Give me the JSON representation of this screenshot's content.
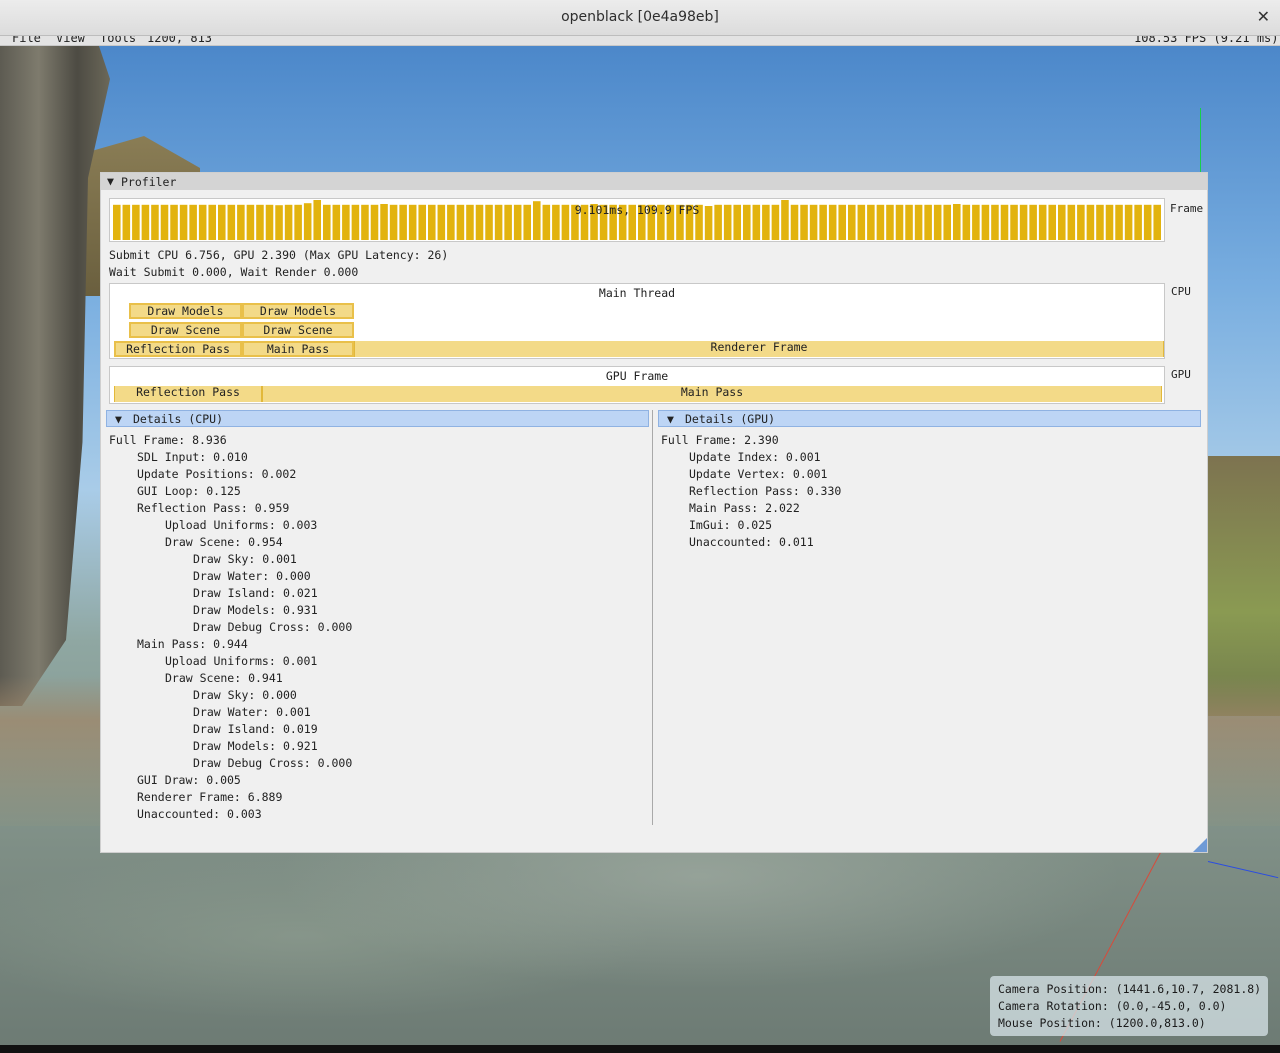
{
  "window": {
    "title": "openblack [0e4a98eb]"
  },
  "menu": {
    "file": "File",
    "view": "View",
    "tools": "Tools",
    "resolution": "1200, 813",
    "fps": "108.53 FPS (9.21 ms)"
  },
  "profiler": {
    "title": "Profiler",
    "frame_graph": {
      "label": "9.101ms, 109.9 FPS",
      "side_label": "Frame",
      "bar_levels": [
        0.88,
        0.88,
        0.88,
        0.88,
        0.88,
        0.88,
        0.88,
        0.88,
        0.88,
        0.88,
        0.88,
        0.88,
        0.88,
        0.88,
        0.88,
        0.88,
        0.88,
        0.88,
        0.88,
        0.88,
        0.88,
        0.88,
        0.88,
        0.88,
        0.88,
        0.88,
        0.88,
        0.88,
        0.88,
        0.88,
        0.88,
        0.88,
        0.88,
        0.88,
        0.88,
        0.88,
        0.88,
        0.88,
        0.88,
        0.88,
        0.88,
        0.88,
        0.88,
        0.88,
        0.88,
        0.88,
        0.88,
        0.88,
        0.88,
        0.88,
        0.88,
        0.88,
        0.88,
        0.88,
        0.88,
        0.88,
        0.88,
        0.88,
        0.88,
        0.88,
        0.88,
        0.88,
        0.88,
        0.88,
        0.88,
        0.88,
        0.88,
        0.88,
        0.88,
        0.88,
        0.88,
        0.88,
        0.88,
        0.88,
        0.88,
        0.88,
        0.88,
        0.88,
        0.88,
        0.88,
        0.88,
        0.88,
        0.88,
        0.88,
        0.88,
        0.88,
        0.88,
        0.88,
        0.88,
        0.88,
        0.88,
        0.88,
        0.88,
        0.88,
        0.88,
        0.88,
        0.88,
        0.88,
        0.88,
        0.88,
        0.88,
        0.88,
        0.88,
        0.88,
        0.88,
        0.88,
        0.88,
        0.88,
        0.88,
        0.88
      ],
      "spikes": [
        [
          21,
          1.0
        ],
        [
          44,
          0.97
        ],
        [
          70,
          1.0
        ],
        [
          20,
          0.92
        ],
        [
          28,
          0.9
        ],
        [
          17,
          0.87
        ],
        [
          50,
          0.9
        ],
        [
          62,
          0.85
        ],
        [
          88,
          0.9
        ]
      ]
    },
    "submit_line": "Submit CPU 6.756, GPU 2.390 (Max GPU Latency: 26)",
    "wait_line": "Wait Submit 0.000, Wait Render 0.000",
    "cpu": {
      "title": "Main Thread",
      "side_label": "CPU",
      "row3": {
        "reflection": "Reflection Pass",
        "main": "Main Pass",
        "renderer": "Renderer Frame"
      },
      "row2": {
        "a": "Draw Scene",
        "b": "Draw Scene"
      },
      "row1": {
        "a": "Draw Models",
        "b": "Draw Models"
      }
    },
    "gpu": {
      "title": "GPU Frame",
      "side_label": "GPU",
      "reflection": "Reflection Pass",
      "main": "Main Pass"
    },
    "details_cpu": {
      "header": "Details (CPU)",
      "lines": [
        "Full Frame: 8.936",
        "SDL Input: 0.010",
        "Update Positions: 0.002",
        "GUI Loop: 0.125",
        "Reflection Pass: 0.959",
        "Upload Uniforms: 0.003",
        "Draw Scene: 0.954",
        "Draw Sky: 0.001",
        "Draw Water: 0.000",
        "Draw Island: 0.021",
        "Draw Models: 0.931",
        "Draw Debug Cross: 0.000",
        "Main Pass: 0.944",
        "Upload Uniforms: 0.001",
        "Draw Scene: 0.941",
        "Draw Sky: 0.000",
        "Draw Water: 0.001",
        "Draw Island: 0.019",
        "Draw Models: 0.921",
        "Draw Debug Cross: 0.000",
        "GUI Draw: 0.005",
        "Renderer Frame: 6.889",
        "Unaccounted: 0.003"
      ],
      "indents": [
        0,
        1,
        1,
        1,
        1,
        2,
        2,
        3,
        3,
        3,
        3,
        3,
        1,
        2,
        2,
        3,
        3,
        3,
        3,
        3,
        1,
        1,
        1
      ]
    },
    "details_gpu": {
      "header": "Details (GPU)",
      "lines": [
        "Full Frame: 2.390",
        "Update Index: 0.001",
        "Update Vertex: 0.001",
        "Reflection Pass: 0.330",
        "Main Pass: 2.022",
        "ImGui: 0.025",
        "Unaccounted: 0.011"
      ],
      "indents": [
        0,
        1,
        1,
        1,
        1,
        1,
        1
      ]
    }
  },
  "camera": {
    "position": "Camera Position: (1441.6,10.7, 2081.8)",
    "rotation": "Camera Rotation: (0.0,-45.0, 0.0)",
    "mouse": "Mouse Position: (1200.0,813.0)"
  },
  "colors": {
    "bar": "#e2b30e",
    "segment_fill": "#f3da88",
    "segment_border": "#e9c04a",
    "details_header": "#bdd5f5"
  },
  "icons": {
    "collapse": "triangle-down-icon",
    "close": "close-icon"
  }
}
